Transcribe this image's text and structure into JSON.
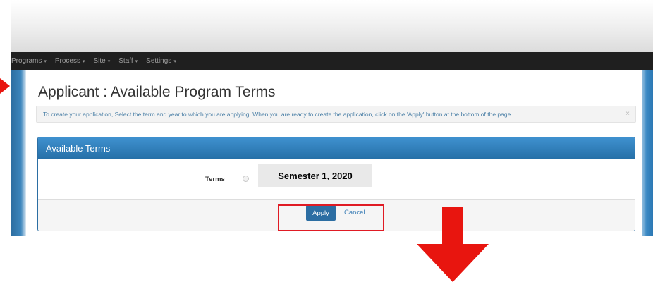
{
  "nav": {
    "items": [
      {
        "label": "Programs",
        "caret": "▾"
      },
      {
        "label": "Process",
        "caret": "▾"
      },
      {
        "label": "Site",
        "caret": "▾"
      },
      {
        "label": "Staff",
        "caret": "▾"
      },
      {
        "label": "Settings",
        "caret": "▾"
      }
    ]
  },
  "page": {
    "title": "Applicant : Available Program Terms"
  },
  "alert": {
    "text": "To create your application, Select the term and year to which you are applying. When you are ready to create the application, click on the 'Apply' button at the bottom of the page.",
    "close": "×"
  },
  "panel": {
    "title": "Available Terms",
    "terms_label": "Terms",
    "term_option": "Semester 1, 2020",
    "apply_label": "Apply",
    "cancel_label": "Cancel"
  },
  "annotations": {
    "highlight_color": "#e01b24",
    "arrow_color": "#e8150f"
  }
}
